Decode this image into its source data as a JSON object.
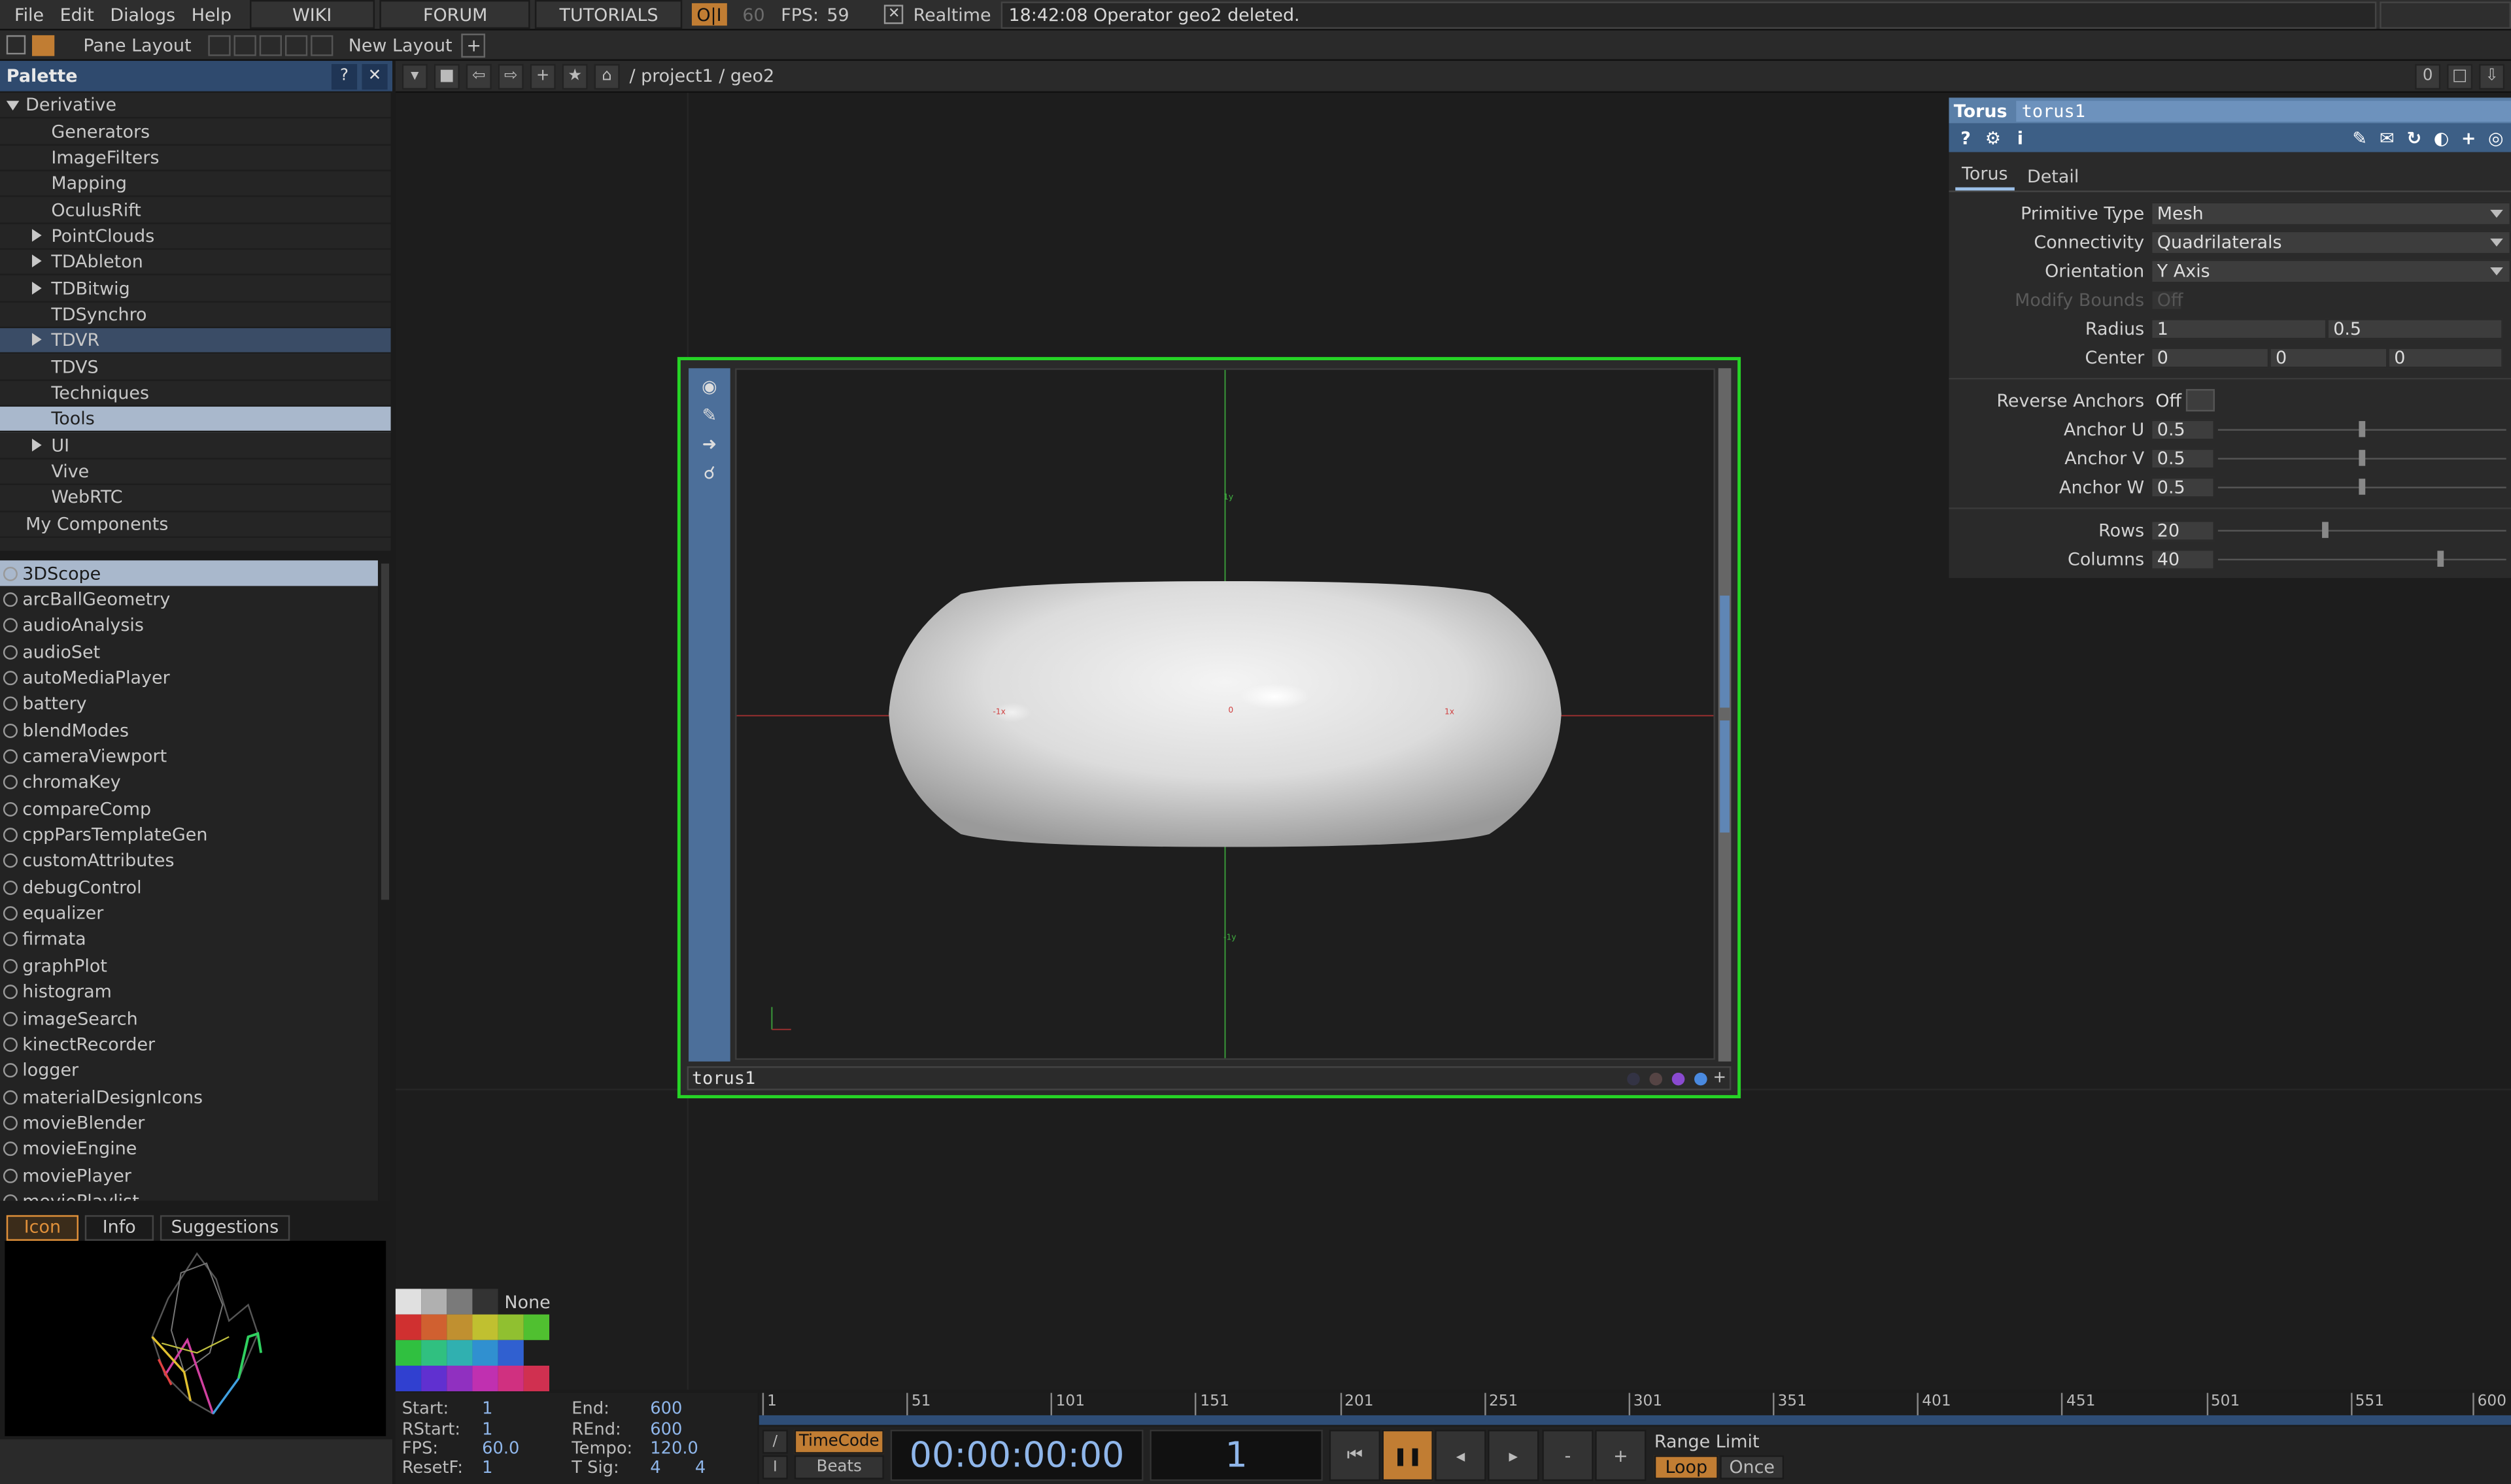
{
  "menu": [
    "File",
    "Edit",
    "Dialogs",
    "Help"
  ],
  "top_tabs": [
    "WIKI",
    "FORUM",
    "TUTORIALS"
  ],
  "oi_badge": "O|I",
  "fps_cap": "60",
  "fps_label": "FPS:",
  "fps_value": "59",
  "realtime_label": "Realtime",
  "status_message": "18:42:08 Operator geo2 deleted.",
  "layout": {
    "pane_layout": "Pane Layout",
    "new_layout": "New Layout"
  },
  "palette": {
    "title": "Palette",
    "tree": [
      {
        "label": "Derivative",
        "indent": 0,
        "arrow": "down"
      },
      {
        "label": "Generators",
        "indent": 2,
        "arrow": ""
      },
      {
        "label": "ImageFilters",
        "indent": 2,
        "arrow": ""
      },
      {
        "label": "Mapping",
        "indent": 2,
        "arrow": ""
      },
      {
        "label": "OculusRift",
        "indent": 2,
        "arrow": ""
      },
      {
        "label": "PointClouds",
        "indent": 2,
        "arrow": "right"
      },
      {
        "label": "TDAbleton",
        "indent": 2,
        "arrow": "right"
      },
      {
        "label": "TDBitwig",
        "indent": 2,
        "arrow": "right"
      },
      {
        "label": "TDSynchro",
        "indent": 2,
        "arrow": ""
      },
      {
        "label": "TDVR",
        "indent": 2,
        "arrow": "right",
        "state": "hl"
      },
      {
        "label": "TDVS",
        "indent": 2,
        "arrow": ""
      },
      {
        "label": "Techniques",
        "indent": 2,
        "arrow": ""
      },
      {
        "label": "Tools",
        "indent": 2,
        "arrow": "",
        "state": "sel"
      },
      {
        "label": "UI",
        "indent": 2,
        "arrow": "right"
      },
      {
        "label": "Vive",
        "indent": 2,
        "arrow": ""
      },
      {
        "label": "WebRTC",
        "indent": 2,
        "arrow": ""
      },
      {
        "label": "My Components",
        "indent": 1,
        "arrow": ""
      }
    ],
    "components": [
      "3DScope",
      "arcBallGeometry",
      "audioAnalysis",
      "audioSet",
      "autoMediaPlayer",
      "battery",
      "blendModes",
      "cameraViewport",
      "chromaKey",
      "compareComp",
      "cppParsTemplateGen",
      "customAttributes",
      "debugControl",
      "equalizer",
      "firmata",
      "graphPlot",
      "histogram",
      "imageSearch",
      "kinectRecorder",
      "logger",
      "materialDesignIcons",
      "movieBlender",
      "movieEngine",
      "moviePlayer",
      "moviePlaylist"
    ],
    "selected_component": "3DScope",
    "icon_tabs": [
      "Icon",
      "Info",
      "Suggestions"
    ]
  },
  "network": {
    "path": "/ project1 / geo2",
    "counter": "0"
  },
  "node": {
    "name": "torus1",
    "axis_labels": {
      "neg_x": "-1x",
      "origin": "0",
      "pos_x": "1x",
      "pos_y": "1y",
      "neg_y": "-1y"
    }
  },
  "params": {
    "op_type": "Torus",
    "op_name": "torus1",
    "tabs": [
      "Torus",
      "Detail"
    ],
    "primitive_type": {
      "label": "Primitive Type",
      "value": "Mesh"
    },
    "connectivity": {
      "label": "Connectivity",
      "value": "Quadrilaterals"
    },
    "orientation": {
      "label": "Orientation",
      "value": "Y Axis"
    },
    "modify_bounds": {
      "label": "Modify Bounds",
      "value": "Off"
    },
    "radius": {
      "label": "Radius",
      "v1": "1",
      "v2": "0.5"
    },
    "center": {
      "label": "Center",
      "v1": "0",
      "v2": "0",
      "v3": "0"
    },
    "reverse_anchors": {
      "label": "Reverse Anchors",
      "value": "Off"
    },
    "anchor_u": {
      "label": "Anchor U",
      "value": "0.5",
      "level": 0.5
    },
    "anchor_v": {
      "label": "Anchor V",
      "value": "0.5",
      "level": 0.5
    },
    "anchor_w": {
      "label": "Anchor W",
      "value": "0.5",
      "level": 0.5
    },
    "rows": {
      "label": "Rows",
      "value": "20",
      "level": 0.37
    },
    "columns": {
      "label": "Columns",
      "value": "40",
      "level": 0.77
    }
  },
  "swatch_none": "None",
  "range": {
    "start_label": "Start:",
    "start": "1",
    "end_label": "End:",
    "end": "600",
    "rstart_label": "RStart:",
    "rstart": "1",
    "rend_label": "REnd:",
    "rend": "600",
    "fps_label": "FPS:",
    "fps": "60.0",
    "tempo_label": "Tempo:",
    "tempo": "120.0",
    "resetf_label": "ResetF:",
    "resetf": "1",
    "tsig_label": "T Sig:",
    "tsig_a": "4",
    "tsig_b": "4"
  },
  "timeline": {
    "ticks": [
      "1",
      "51",
      "101",
      "151",
      "201",
      "251",
      "301",
      "351",
      "401",
      "451",
      "501",
      "551",
      "600"
    ],
    "timecode_label": "TimeCode",
    "beats_label": "Beats",
    "timecode": "00:00:00:00",
    "frame": "1",
    "range_limit": "Range Limit",
    "loop": "Loop",
    "once": "Once",
    "minus": "-",
    "plus": "+"
  }
}
